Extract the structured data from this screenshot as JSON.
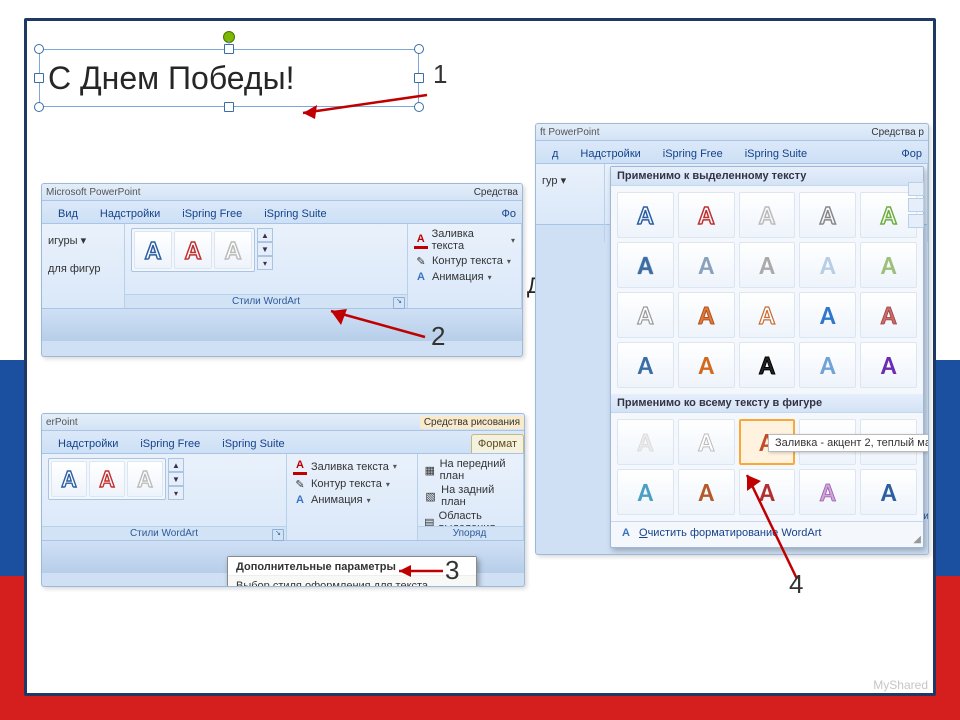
{
  "steps": {
    "s1": "1",
    "s2": "2",
    "s3": "3",
    "s4": "4"
  },
  "textbox": {
    "text": "С Днем Победы!"
  },
  "frag_text": "Дне",
  "myshared": "MyShared",
  "panel2": {
    "title_left": "Microsoft PowerPoint",
    "title_right": "Средства",
    "tabs": {
      "view": "Вид",
      "addins": "Надстройки",
      "isf": "iSpring Free",
      "iss": "iSpring Suite",
      "fmt": "Фо"
    },
    "left_trunc": {
      "a": "игуры ▾",
      "b": "для фигур"
    },
    "wordart_group": "Стили WordArt",
    "textfill": "Заливка текста",
    "textoutline": "Контур текста",
    "animation": "Анимация"
  },
  "panel3": {
    "title_left": "erPoint",
    "title_right": "Средства рисования",
    "tabs": {
      "addins": "Надстройки",
      "isf": "iSpring Free",
      "iss": "iSpring Suite",
      "fmt": "Формат"
    },
    "wordart_group": "Стили WordArt",
    "textfill": "Заливка текста",
    "textoutline": "Контур текста",
    "animation": "Анимация",
    "front": "На передний план",
    "back": "На задний план",
    "selpane": "Область выделения",
    "arrange_group": "Упоряд",
    "tooltip_title": "Дополнительные параметры",
    "tooltip_body": "Выбор стиля оформления для текста."
  },
  "panel4": {
    "title_left": "ft PowerPoint",
    "title_right": "Средства р",
    "tabs": {
      "view": "д",
      "addins": "Надстройки",
      "isf": "iSpring Free",
      "iss": "iSpring Suite",
      "fmt": "Фор"
    },
    "left_trunc": {
      "a": "гур ▾"
    },
    "header1": "Применимо к выделенному тексту",
    "header2": "Применимо ко всему тексту в фигуре",
    "hover_tip": "Заливка - акцент 2, теплый ма",
    "clear": "Очистить форматирование WordArt",
    "clear_u": "О",
    "side_label": "Стили"
  }
}
